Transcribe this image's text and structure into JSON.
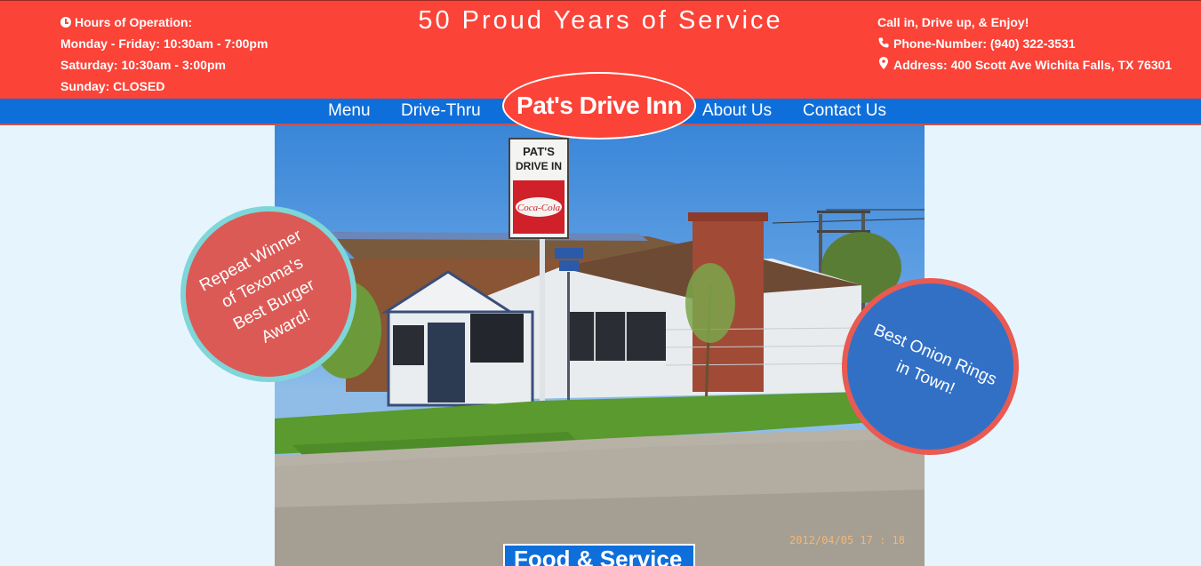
{
  "header": {
    "hours": {
      "title": "Hours of Operation:",
      "weekday": "Monday - Friday: 10:30am - 7:00pm",
      "saturday": "Saturday: 10:30am - 3:00pm",
      "sunday": "Sunday: CLOSED"
    },
    "tagline": "50 Proud Years of Service",
    "contact": {
      "intro": "Call in, Drive up, & Enjoy!",
      "phone": "Phone-Number: (940) 322-3531",
      "address": "Address: 400 Scott Ave Wichita Falls, TX 76301"
    }
  },
  "nav": {
    "menu": "Menu",
    "drive_thru": "Drive-Thru",
    "brand": "Pat's Drive Inn",
    "about": "About Us",
    "contact": "Contact Us"
  },
  "hero": {
    "photo_stamp": "2012/04/05  17 : 18",
    "sign_text": "PAT'S\nDRIVE IN",
    "sign_brand": "Coca-Cola",
    "section_tab": "Food & Service"
  },
  "badges": {
    "left": "Repeat Winner of Texoma's Best Burger Award!",
    "right": "Best Onion Rings in Town!"
  },
  "colors": {
    "header_red": "#fb4338",
    "nav_blue": "#0e6fdb",
    "page_bg": "#e6f5fd",
    "badge_left": "#dc5a55",
    "badge_right": "#3270c6"
  },
  "icons": {
    "hours": "clock-icon",
    "phone": "phone-icon",
    "address": "map-marker-icon"
  }
}
